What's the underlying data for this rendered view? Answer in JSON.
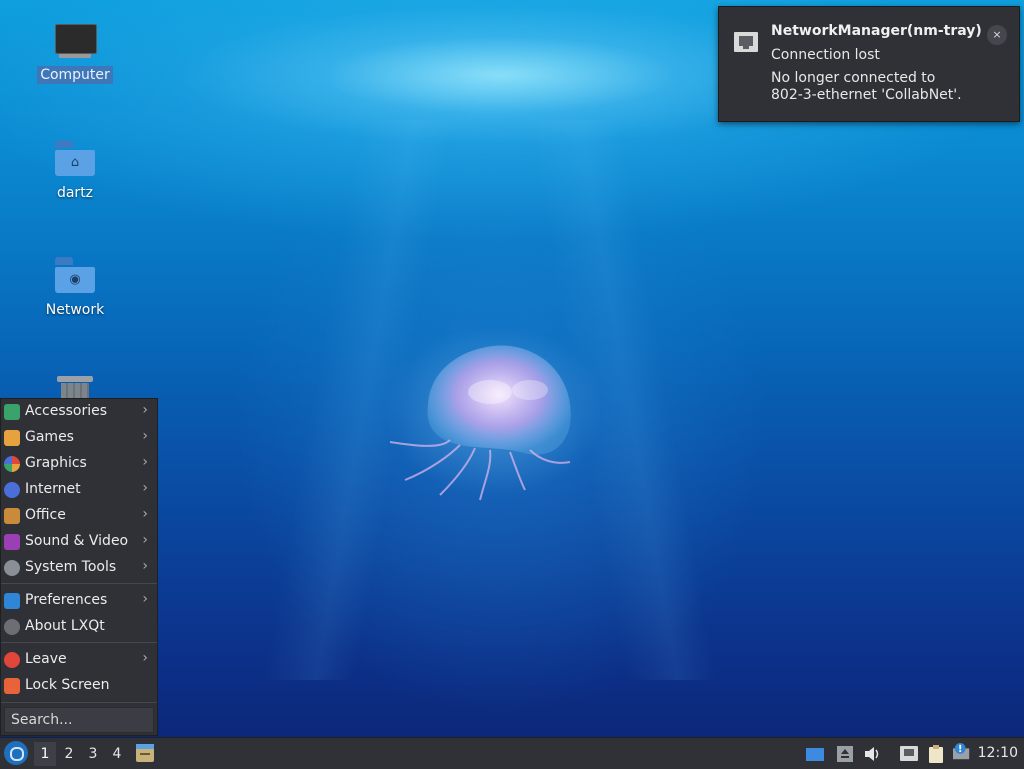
{
  "desktop": {
    "icons": [
      {
        "label": "Computer",
        "icon": "computer-icon"
      },
      {
        "label": "dartz",
        "icon": "home-folder-icon"
      },
      {
        "label": "Network",
        "icon": "network-folder-icon"
      },
      {
        "label": "",
        "icon": "trash-icon"
      }
    ]
  },
  "notification": {
    "title": "NetworkManager(nm-tray)",
    "summary": "Connection lost",
    "body": "No longer connected to 802-3-ethernet 'CollabNet'.",
    "close": "×",
    "icon": "ethernet-icon"
  },
  "menu": {
    "items": [
      {
        "label": "Accessories",
        "icon": "accessories-icon",
        "submenu": true,
        "color": "#3aa36b"
      },
      {
        "label": "Games",
        "icon": "games-icon",
        "submenu": true,
        "color": "#e6a23c"
      },
      {
        "label": "Graphics",
        "icon": "graphics-icon",
        "submenu": true,
        "color": "#d9506a"
      },
      {
        "label": "Internet",
        "icon": "internet-icon",
        "submenu": true,
        "color": "#4a6fd9"
      },
      {
        "label": "Office",
        "icon": "office-icon",
        "submenu": true,
        "color": "#c98a3a"
      },
      {
        "label": "Sound & Video",
        "icon": "sound-video-icon",
        "submenu": true,
        "color": "#9b3fb5"
      },
      {
        "label": "System Tools",
        "icon": "system-tools-icon",
        "submenu": true,
        "color": "#8a8f96"
      },
      {
        "label": "Preferences",
        "icon": "preferences-icon",
        "submenu": true,
        "color": "#2f86d6"
      },
      {
        "label": "About LXQt",
        "icon": "info-icon",
        "submenu": false,
        "color": "#6b6f75"
      },
      {
        "label": "Leave",
        "icon": "power-icon",
        "submenu": true,
        "color": "#e0463a"
      },
      {
        "label": "Lock Screen",
        "icon": "lock-icon",
        "submenu": false,
        "color": "#e8633a"
      }
    ],
    "arrow": "›",
    "search_placeholder": "Search..."
  },
  "taskbar": {
    "workspaces": [
      "1",
      "2",
      "3",
      "4"
    ],
    "active_workspace": "1",
    "clock": "12:10",
    "tray_icons": [
      "show-desktop-icon",
      "removable-media-icon",
      "volume-icon",
      "network-tray-icon",
      "clipboard-icon",
      "update-notifier-icon"
    ]
  }
}
